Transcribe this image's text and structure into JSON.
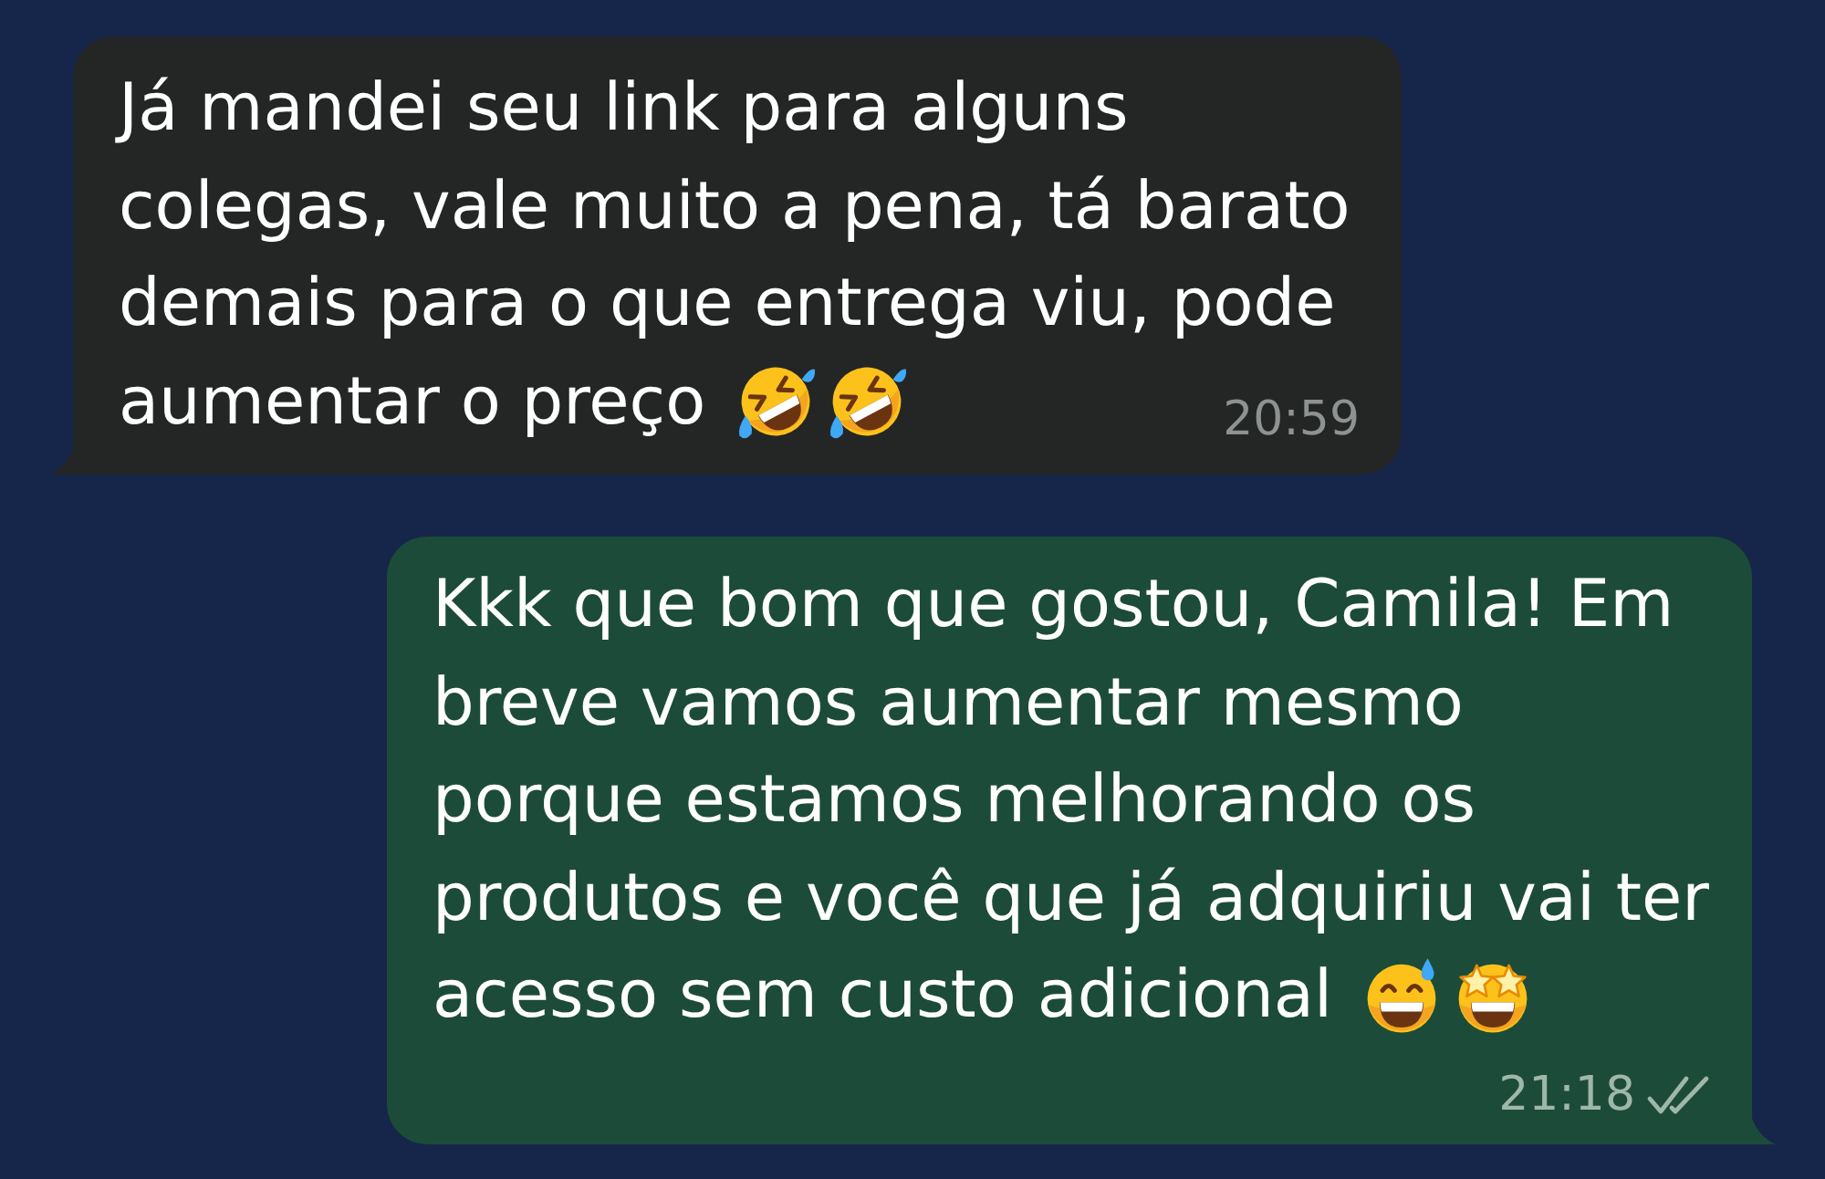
{
  "messages": [
    {
      "kind": "incoming",
      "lines": [
        "Já mandei seu link para alguns",
        "colegas, vale muito a pena, tá barato",
        "demais para o que entrega viu, pode",
        "aumentar o preço"
      ],
      "emojis": [
        {
          "kind": "rofl"
        },
        {
          "kind": "rofl"
        }
      ],
      "time": "20:59"
    },
    {
      "kind": "outgoing",
      "lines": [
        "Kkk que bom que gostou, Camila! Em",
        "breve vamos aumentar mesmo",
        "porque estamos melhorando os",
        "produtos e você que já adquiriu vai ter",
        "acesso sem custo adicional"
      ],
      "emojis": [
        {
          "kind": "sweat-grin"
        },
        {
          "kind": "star-struck"
        }
      ],
      "time": "21:18",
      "read": false
    }
  ]
}
